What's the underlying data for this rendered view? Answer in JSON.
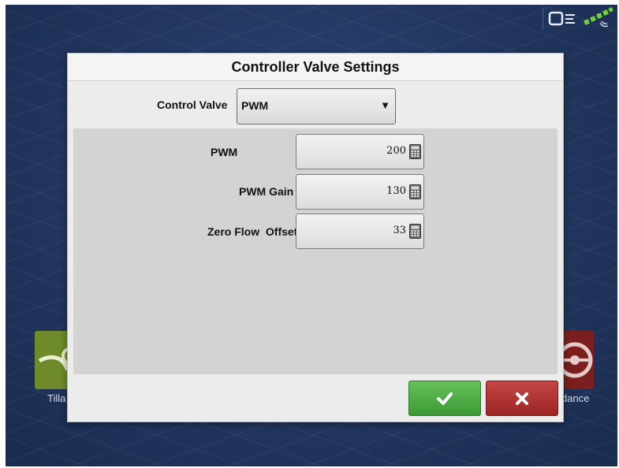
{
  "status_icons": [
    "display-connection-icon",
    "gps-signal-icon"
  ],
  "background": {
    "left_tile_label": "Tilla",
    "right_tile_label": "dance",
    "left_tile_icon": "tillage-icon",
    "right_tile_icon": "steering-wheel-icon"
  },
  "dialog": {
    "title": "Controller Valve Settings",
    "control_valve": {
      "label": "Control Valve",
      "selected": "PWM"
    },
    "fields": [
      {
        "label": "PWM",
        "value": "200",
        "icon": "calculator-icon"
      },
      {
        "label": "PWM Gain",
        "value": "130",
        "icon": "calculator-icon"
      },
      {
        "label": "Zero Flow  Offset",
        "value": "33",
        "icon": "calculator-icon"
      }
    ],
    "buttons": {
      "accept_icon": "checkmark-icon",
      "cancel_icon": "close-icon"
    }
  },
  "colors": {
    "accept": "#4caf45",
    "cancel": "#b03333",
    "background": "#22365f"
  }
}
